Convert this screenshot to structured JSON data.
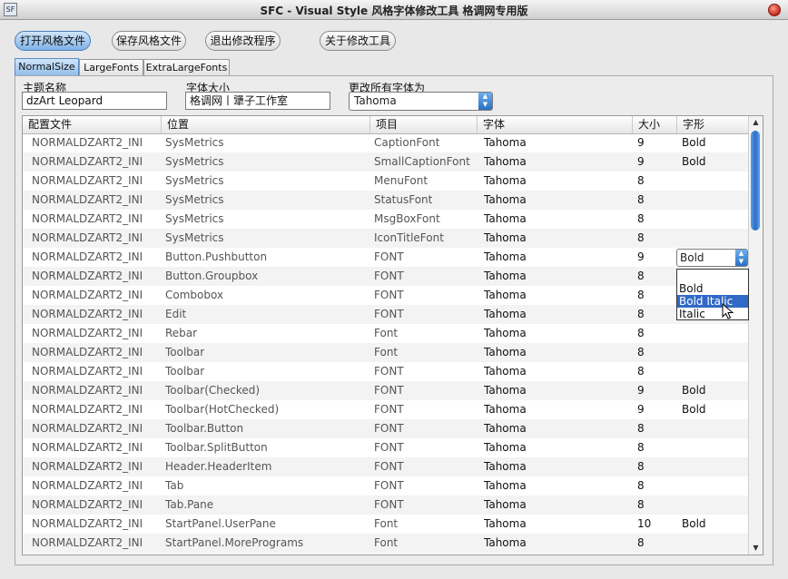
{
  "window": {
    "title": "SFC - Visual Style 风格字体修改工具 格调网专用版",
    "icon": "app-icon"
  },
  "toolbar": {
    "open_label": "打开风格文件",
    "save_label": "保存风格文件",
    "exit_label": "退出修改程序",
    "about_label": "关于修改工具"
  },
  "tabs": [
    {
      "label": "NormalSize",
      "active": true
    },
    {
      "label": "LargeFonts",
      "active": false
    },
    {
      "label": "ExtraLargeFonts",
      "active": false
    }
  ],
  "form": {
    "theme_name_label": "主题名称",
    "theme_name_value": "dzArt Leopard",
    "font_size_label": "字体大小",
    "font_size_value": "格调网丨犟子工作室",
    "change_all_label": "更改所有字体为",
    "change_all_value": "Tahoma"
  },
  "table": {
    "headers": [
      "配置文件",
      "位置",
      "项目",
      "字体",
      "大小",
      "字形"
    ],
    "rows": [
      [
        "NORMALDZART2_INI",
        "SysMetrics",
        "CaptionFont",
        "Tahoma",
        "9",
        "Bold"
      ],
      [
        "NORMALDZART2_INI",
        "SysMetrics",
        "SmallCaptionFont",
        "Tahoma",
        "9",
        "Bold"
      ],
      [
        "NORMALDZART2_INI",
        "SysMetrics",
        "MenuFont",
        "Tahoma",
        "8",
        ""
      ],
      [
        "NORMALDZART2_INI",
        "SysMetrics",
        "StatusFont",
        "Tahoma",
        "8",
        ""
      ],
      [
        "NORMALDZART2_INI",
        "SysMetrics",
        "MsgBoxFont",
        "Tahoma",
        "8",
        ""
      ],
      [
        "NORMALDZART2_INI",
        "SysMetrics",
        "IconTitleFont",
        "Tahoma",
        "8",
        ""
      ],
      [
        "NORMALDZART2_INI",
        "Button.Pushbutton",
        "FONT",
        "Tahoma",
        "9",
        ""
      ],
      [
        "NORMALDZART2_INI",
        "Button.Groupbox",
        "FONT",
        "Tahoma",
        "8",
        ""
      ],
      [
        "NORMALDZART2_INI",
        "Combobox",
        "FONT",
        "Tahoma",
        "8",
        ""
      ],
      [
        "NORMALDZART2_INI",
        "Edit",
        "FONT",
        "Tahoma",
        "8",
        ""
      ],
      [
        "NORMALDZART2_INI",
        "Rebar",
        "Font",
        "Tahoma",
        "8",
        ""
      ],
      [
        "NORMALDZART2_INI",
        "Toolbar",
        "Font",
        "Tahoma",
        "8",
        ""
      ],
      [
        "NORMALDZART2_INI",
        "Toolbar",
        "FONT",
        "Tahoma",
        "8",
        ""
      ],
      [
        "NORMALDZART2_INI",
        "Toolbar(Checked)",
        "FONT",
        "Tahoma",
        "9",
        "Bold"
      ],
      [
        "NORMALDZART2_INI",
        "Toolbar(HotChecked)",
        "FONT",
        "Tahoma",
        "9",
        "Bold"
      ],
      [
        "NORMALDZART2_INI",
        "Toolbar.Button",
        "FONT",
        "Tahoma",
        "8",
        ""
      ],
      [
        "NORMALDZART2_INI",
        "Toolbar.SplitButton",
        "FONT",
        "Tahoma",
        "8",
        ""
      ],
      [
        "NORMALDZART2_INI",
        "Header.HeaderItem",
        "FONT",
        "Tahoma",
        "8",
        ""
      ],
      [
        "NORMALDZART2_INI",
        "Tab",
        "FONT",
        "Tahoma",
        "8",
        ""
      ],
      [
        "NORMALDZART2_INI",
        "Tab.Pane",
        "FONT",
        "Tahoma",
        "8",
        ""
      ],
      [
        "NORMALDZART2_INI",
        "StartPanel.UserPane",
        "Font",
        "Tahoma",
        "10",
        "Bold"
      ],
      [
        "NORMALDZART2_INI",
        "StartPanel.MorePrograms",
        "Font",
        "Tahoma",
        "8",
        ""
      ]
    ]
  },
  "style_dropdown": {
    "value": "Bold",
    "options": [
      "",
      "Bold",
      "Bold Italic",
      "Italic"
    ],
    "highlighted": "Bold Italic"
  },
  "colors": {
    "accent": "#3169c6",
    "scroll_thumb": "#2c6ec6",
    "close": "#c4281a"
  }
}
